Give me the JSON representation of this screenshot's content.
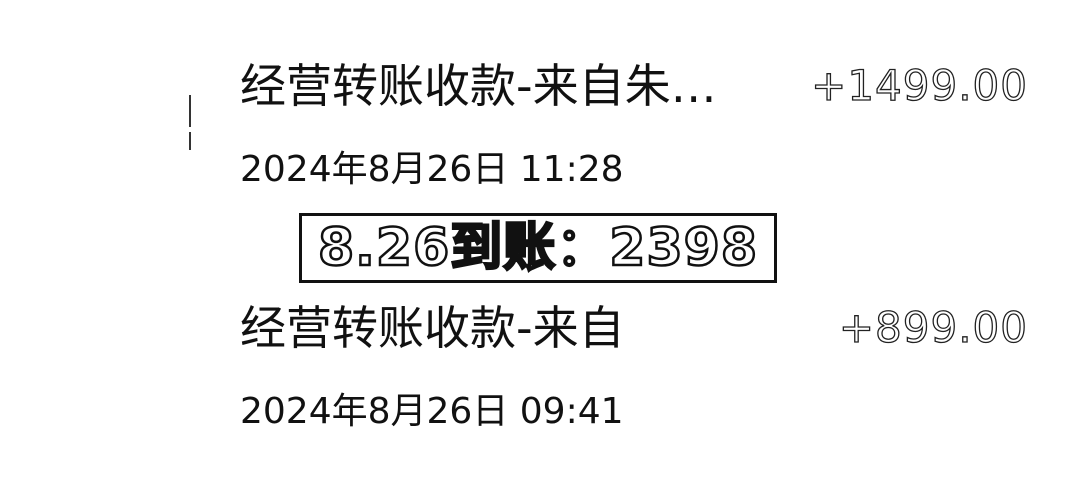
{
  "transactions": [
    {
      "title": "经营转账收款-来自朱…",
      "amount": "+1499.00",
      "datetime": "2024年8月26日 11:28"
    },
    {
      "title": "经营转账收款-来自",
      "amount": "+899.00",
      "datetime": "2024年8月26日 09:41"
    }
  ],
  "annotation": {
    "text": "8.26到账：2398"
  }
}
